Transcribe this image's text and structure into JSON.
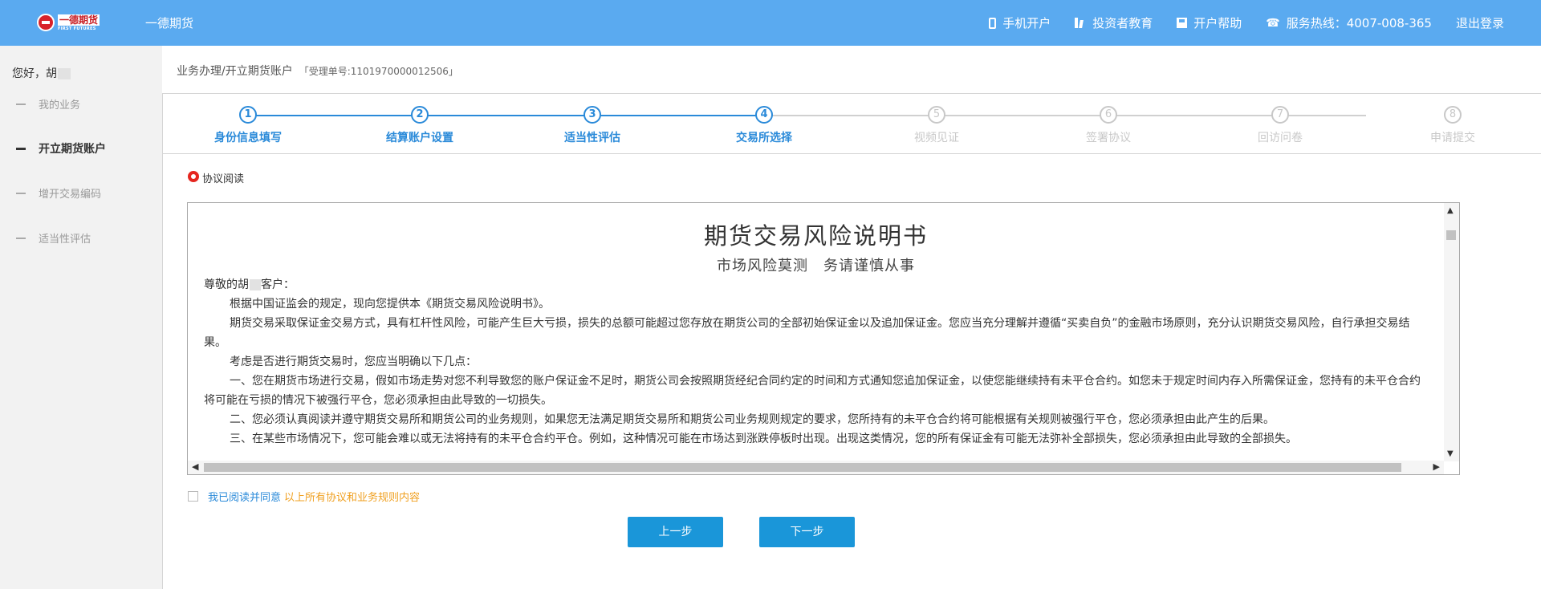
{
  "header": {
    "logo": {
      "cn": "一德期货",
      "en": "FIRST FUTURES"
    },
    "brand": "一德期货",
    "nav": [
      {
        "icon": "mobile-phone-icon",
        "label": "手机开户"
      },
      {
        "icon": "books-icon",
        "label": "投资者教育"
      },
      {
        "icon": "floppy-disk-icon",
        "label": "开户帮助"
      },
      {
        "icon": "telephone-icon",
        "label": "服务热线：4007-008-365"
      },
      {
        "icon": "",
        "label": "退出登录"
      }
    ]
  },
  "sidebar": {
    "greeting": "您好，胡",
    "items": [
      {
        "label": "我的业务",
        "active": false
      },
      {
        "label": "开立期货账户",
        "active": true
      },
      {
        "label": "增开交易编码",
        "active": false
      },
      {
        "label": "适当性评估",
        "active": false
      }
    ]
  },
  "breadcrumb": {
    "path": "业务办理/开立期货账户",
    "ticket": "「受理单号:1101970000012506」"
  },
  "steps": [
    {
      "num": "1",
      "label": "身份信息填写",
      "done": true
    },
    {
      "num": "2",
      "label": "结算账户设置",
      "done": true
    },
    {
      "num": "3",
      "label": "适当性评估",
      "done": true
    },
    {
      "num": "4",
      "label": "交易所选择",
      "done": true
    },
    {
      "num": "5",
      "label": "视频见证",
      "done": false
    },
    {
      "num": "6",
      "label": "签署协议",
      "done": false
    },
    {
      "num": "7",
      "label": "回访问卷",
      "done": false
    },
    {
      "num": "8",
      "label": "申请提交",
      "done": false
    }
  ],
  "section": {
    "title": "协议阅读"
  },
  "document": {
    "title": "期货交易风险说明书",
    "subtitle": "市场风险莫测　务请谨慎从事",
    "salutation_a": "尊敬的胡",
    "salutation_b": "客户：",
    "paragraphs": [
      "根据中国证监会的规定，现向您提供本《期货交易风险说明书》。",
      "期货交易采取保证金交易方式，具有杠杆性风险，可能产生巨大亏损，损失的总额可能超过您存放在期货公司的全部初始保证金以及追加保证金。您应当充分理解并遵循“买卖自负”的金融市场原则，充分认识期货交易风险，自行承担交易结果。",
      "考虑是否进行期货交易时，您应当明确以下几点：",
      "一、您在期货市场进行交易，假如市场走势对您不利导致您的账户保证金不足时，期货公司会按照期货经纪合同约定的时间和方式通知您追加保证金，以使您能继续持有未平仓合约。如您未于规定时间内存入所需保证金，您持有的未平仓合约将可能在亏损的情况下被强行平仓，您必须承担由此导致的一切损失。",
      "二、您必须认真阅读并遵守期货交易所和期货公司的业务规则，如果您无法满足期货交易所和期货公司业务规则规定的要求，您所持有的未平仓合约将可能根据有关规则被强行平仓，您必须承担由此产生的后果。",
      "三、在某些市场情况下，您可能会难以或无法将持有的未平仓合约平仓。例如，这种情况可能在市场达到涨跌停板时出现。出现这类情况，您的所有保证金有可能无法弥补全部损失，您必须承担由此导致的全部损失。"
    ]
  },
  "agreement": {
    "prefix": "我已阅读并同意",
    "link": "以上所有协议和业务规则内容"
  },
  "buttons": {
    "prev": "上一步",
    "next": "下一步"
  },
  "colors": {
    "header": "#5aaaf0",
    "accent": "#2a8ad9",
    "button": "#1a96d9",
    "warning_link": "#f0a020",
    "radio": "#e5261f"
  }
}
